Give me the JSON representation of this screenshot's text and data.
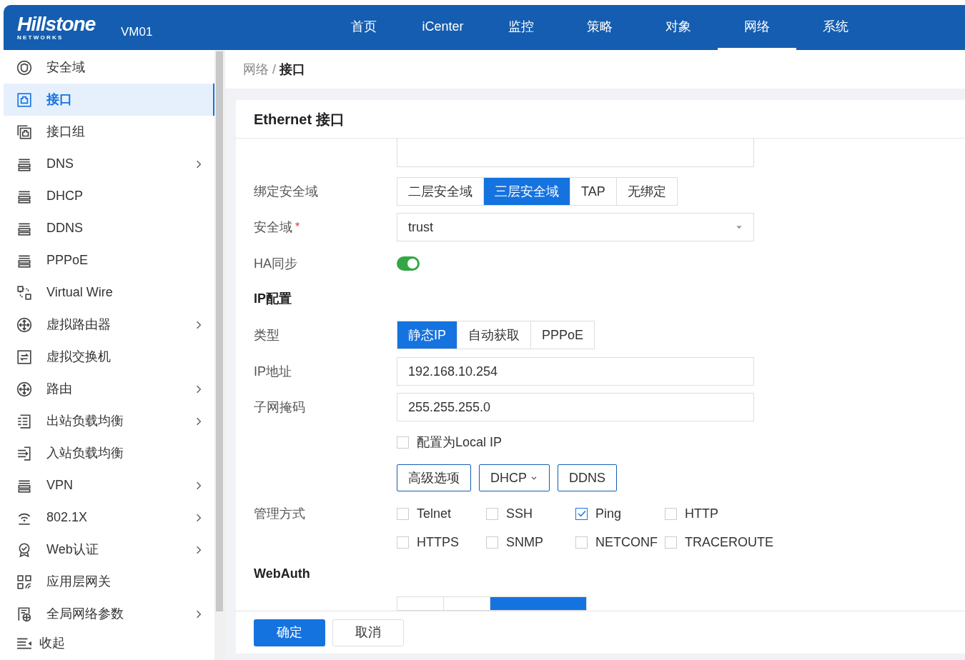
{
  "header": {
    "logo": "Hillstone",
    "logo_sub": "N E T W O R K S",
    "device": "VM01",
    "nav": [
      {
        "label": "首页",
        "selected": false
      },
      {
        "label": "iCenter",
        "selected": false
      },
      {
        "label": "监控",
        "selected": false
      },
      {
        "label": "策略",
        "selected": false
      },
      {
        "label": "对象",
        "selected": false
      },
      {
        "label": "网络",
        "selected": true
      },
      {
        "label": "系统",
        "selected": false
      }
    ]
  },
  "sidebar": {
    "items": [
      {
        "label": "安全域",
        "kind": "shield",
        "has_submenu": false,
        "selected": false
      },
      {
        "label": "接口",
        "kind": "port",
        "has_submenu": false,
        "selected": true
      },
      {
        "label": "接口组",
        "kind": "port-group",
        "has_submenu": false,
        "selected": false
      },
      {
        "label": "DNS",
        "kind": "server",
        "has_submenu": true,
        "selected": false
      },
      {
        "label": "DHCP",
        "kind": "server",
        "has_submenu": false,
        "selected": false
      },
      {
        "label": "DDNS",
        "kind": "server",
        "has_submenu": false,
        "selected": false
      },
      {
        "label": "PPPoE",
        "kind": "server",
        "has_submenu": false,
        "selected": false
      },
      {
        "label": "Virtual Wire",
        "kind": "wire",
        "has_submenu": false,
        "selected": false
      },
      {
        "label": "虚拟路由器",
        "kind": "router",
        "has_submenu": true,
        "selected": false
      },
      {
        "label": "虚拟交换机",
        "kind": "switch",
        "has_submenu": false,
        "selected": false
      },
      {
        "label": "路由",
        "kind": "router",
        "has_submenu": true,
        "selected": false
      },
      {
        "label": "出站负载均衡",
        "kind": "lb-out",
        "has_submenu": true,
        "selected": false
      },
      {
        "label": "入站负载均衡",
        "kind": "lb-in",
        "has_submenu": false,
        "selected": false
      },
      {
        "label": "VPN",
        "kind": "server",
        "has_submenu": true,
        "selected": false
      },
      {
        "label": "802.1X",
        "kind": "wifi",
        "has_submenu": true,
        "selected": false
      },
      {
        "label": "Web认证",
        "kind": "badge",
        "has_submenu": true,
        "selected": false
      },
      {
        "label": "应用层网关",
        "kind": "grid",
        "has_submenu": false,
        "selected": false
      },
      {
        "label": "全局网络参数",
        "kind": "globe",
        "has_submenu": true,
        "selected": false
      }
    ],
    "collapse": "收起"
  },
  "breadcrumb": {
    "parent": "网络",
    "separator": "/",
    "current": "接口"
  },
  "card": {
    "title": "Ethernet 接口"
  },
  "form": {
    "bind_zone": {
      "label": "绑定安全域",
      "options": [
        {
          "label": "二层安全域",
          "selected": false
        },
        {
          "label": "三层安全域",
          "selected": true
        },
        {
          "label": "TAP",
          "selected": false
        },
        {
          "label": "无绑定",
          "selected": false
        }
      ]
    },
    "zone": {
      "label": "安全域",
      "required_mark": "*",
      "value": "trust"
    },
    "ha_sync": {
      "label": "HA同步",
      "on": true
    },
    "ip_section": "IP配置",
    "type": {
      "label": "类型",
      "options": [
        {
          "label": "静态IP",
          "selected": true
        },
        {
          "label": "自动获取",
          "selected": false
        },
        {
          "label": "PPPoE",
          "selected": false
        }
      ]
    },
    "ip": {
      "label": "IP地址",
      "value": "192.168.10.254"
    },
    "mask": {
      "label": "子网掩码",
      "value": "255.255.255.0"
    },
    "local_ip": {
      "label": "配置为Local IP",
      "checked": false
    },
    "buttons": [
      {
        "label": "高级选项",
        "dropdown": false
      },
      {
        "label": "DHCP",
        "dropdown": true
      },
      {
        "label": "DDNS",
        "dropdown": false
      }
    ],
    "management": {
      "label": "管理方式",
      "options": [
        {
          "label": "Telnet",
          "checked": false
        },
        {
          "label": "SSH",
          "checked": false
        },
        {
          "label": "Ping",
          "checked": true
        },
        {
          "label": "HTTP",
          "checked": false
        },
        {
          "label": "HTTPS",
          "checked": false
        },
        {
          "label": "SNMP",
          "checked": false
        },
        {
          "label": "NETCONF",
          "checked": false
        },
        {
          "label": "TRACEROUTE",
          "checked": false
        }
      ]
    },
    "webauth_section": "WebAuth",
    "webauth_options": [
      {
        "selected": false
      },
      {
        "selected": false
      },
      {
        "selected": true
      }
    ]
  },
  "footer": {
    "ok": "确定",
    "cancel": "取消"
  }
}
